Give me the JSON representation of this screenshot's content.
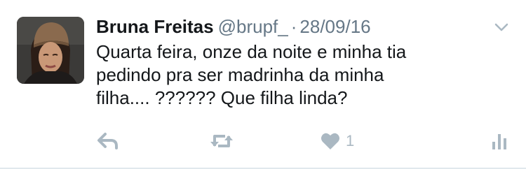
{
  "tweet": {
    "author": {
      "display_name": "Bruna Freitas",
      "handle": "@brupf_",
      "avatar": "profile-photo"
    },
    "separator": "·",
    "date": "28/09/16",
    "text_lines": [
      "Quarta feira, onze da noite e minha tia",
      "pedindo pra ser madrinha da minha",
      "filha.... ?????? Que filha linda?"
    ],
    "actions": {
      "reply": {
        "icon": "reply-icon"
      },
      "retweet": {
        "icon": "retweet-icon"
      },
      "like": {
        "icon": "heart-icon",
        "count": "1"
      },
      "analytics": {
        "icon": "bar-chart-icon"
      }
    },
    "menu_icon": "chevron-down-icon"
  },
  "colors": {
    "text_primary": "#14171a",
    "text_secondary": "#657786",
    "icon_gray": "#aab8c2",
    "divider": "#e1e8ed"
  }
}
